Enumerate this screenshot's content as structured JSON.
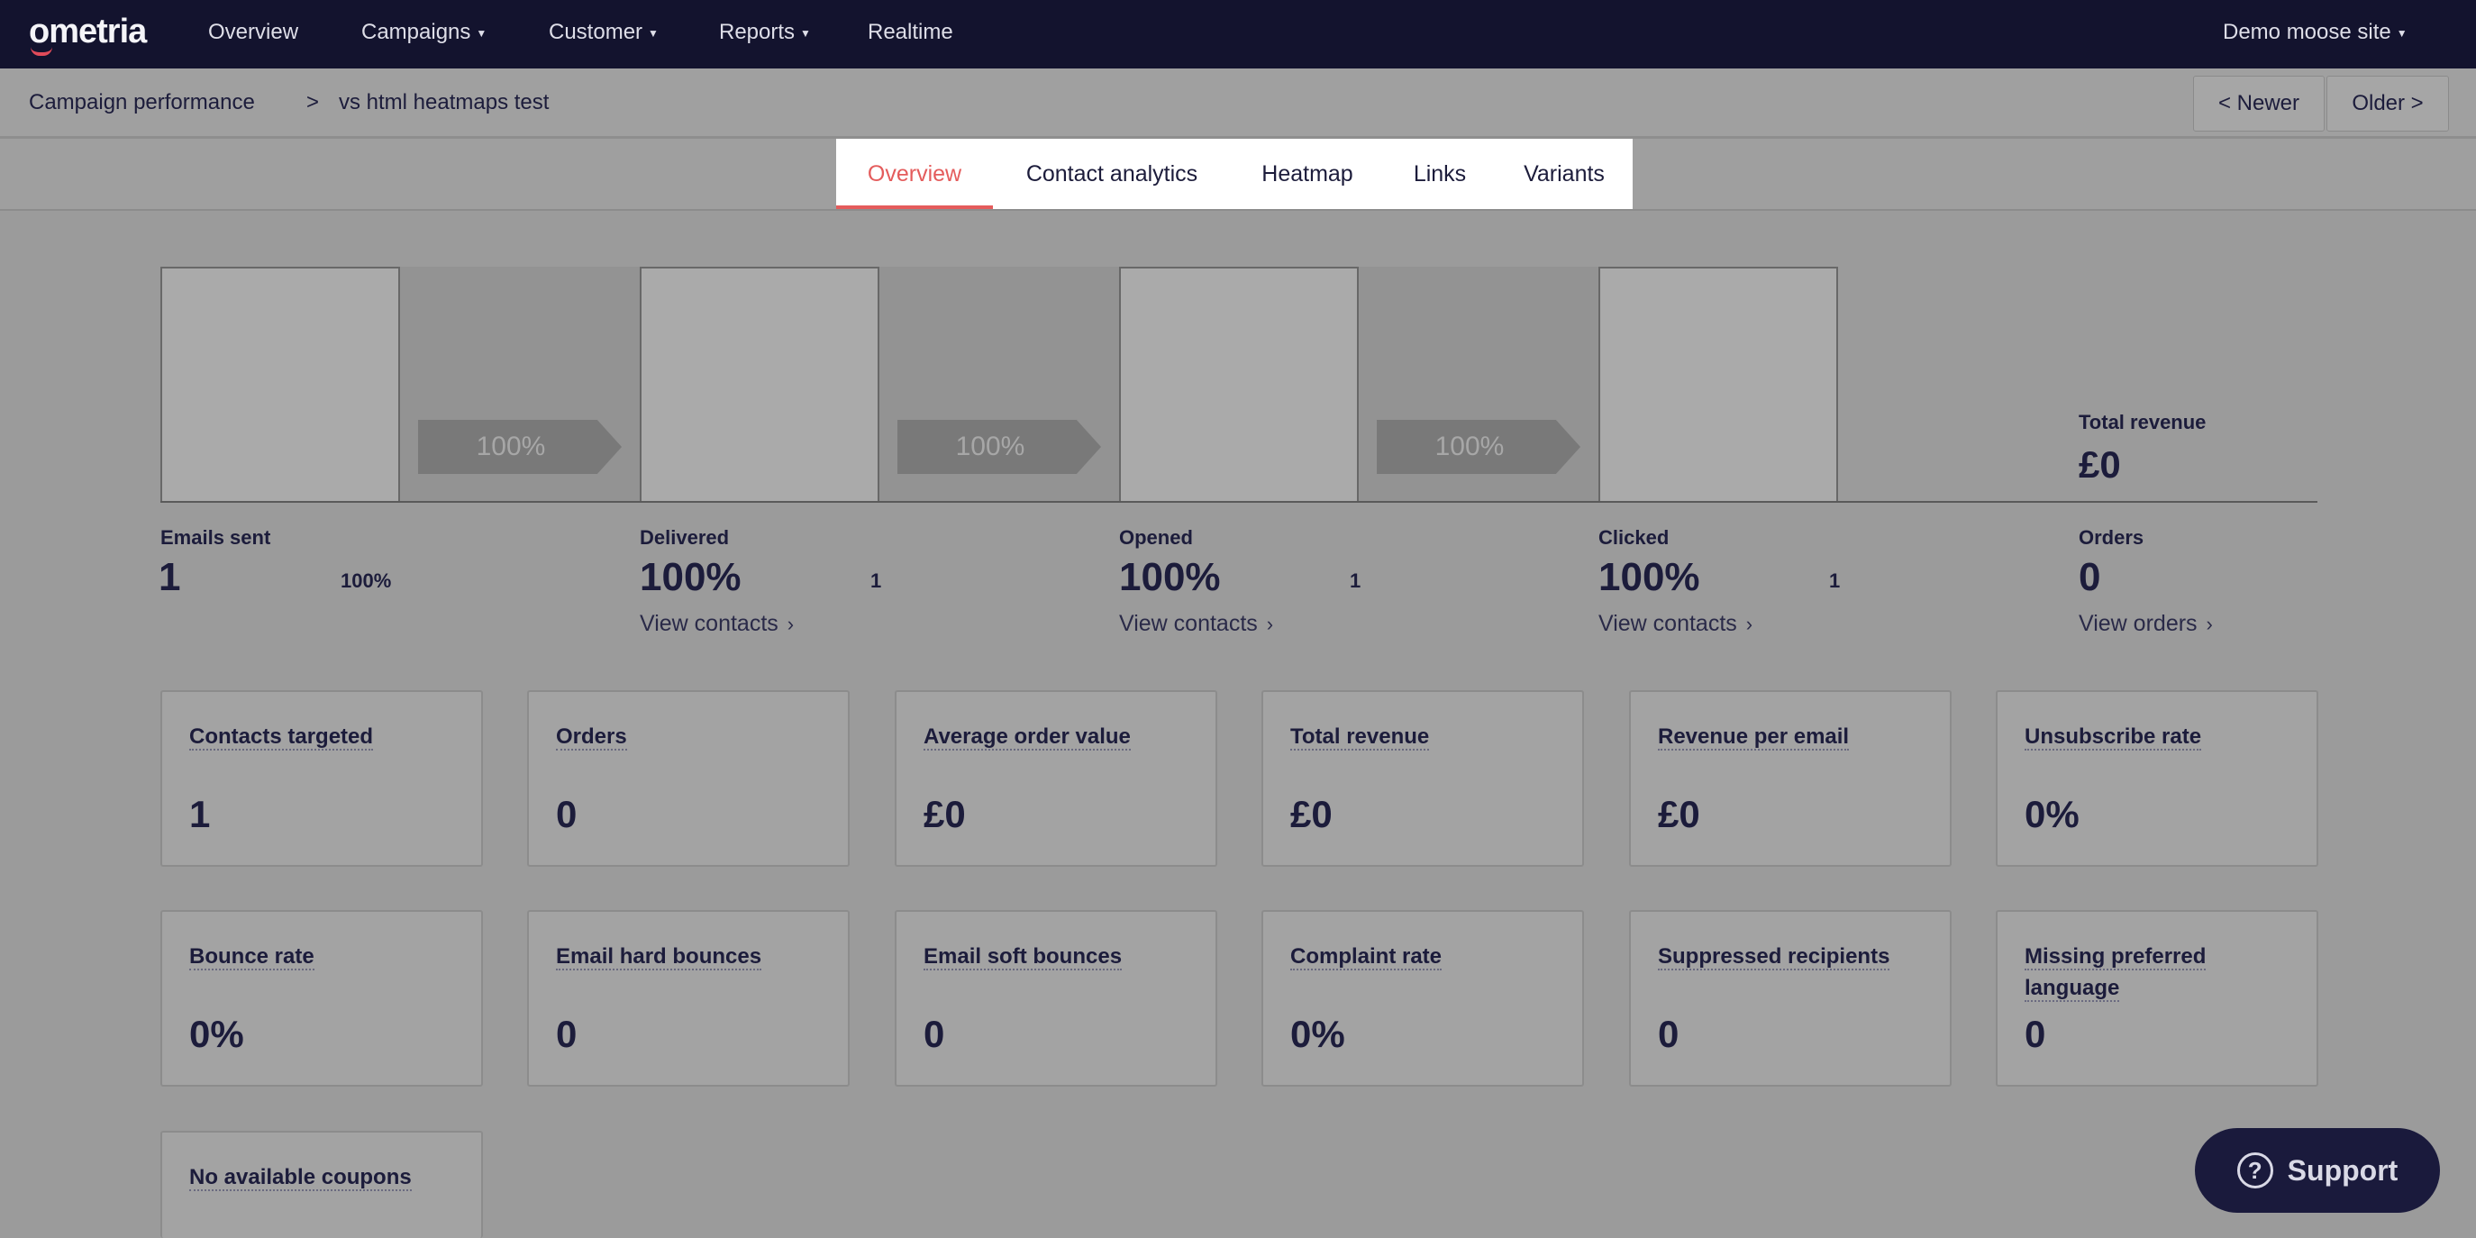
{
  "topnav": {
    "logo": "ometria",
    "items": [
      {
        "label": "Overview",
        "caret": false
      },
      {
        "label": "Campaigns",
        "caret": true
      },
      {
        "label": "Customer",
        "caret": true
      },
      {
        "label": "Reports",
        "caret": true
      },
      {
        "label": "Realtime",
        "caret": false
      }
    ],
    "site_selector": "Demo moose site"
  },
  "breadcrumb": {
    "root": "Campaign performance",
    "separator": ">",
    "current": "vs html heatmaps test",
    "newer_button": "< Newer",
    "older_button": "Older >"
  },
  "tabs": [
    {
      "label": "Overview",
      "active": true
    },
    {
      "label": "Contact analytics",
      "active": false
    },
    {
      "label": "Heatmap",
      "active": false
    },
    {
      "label": "Links",
      "active": false
    },
    {
      "label": "Variants",
      "active": false
    }
  ],
  "funnel": {
    "arrows": [
      "100%",
      "100%",
      "100%"
    ],
    "stages": [
      {
        "label": "Emails sent",
        "value": "1",
        "secondary": "100%",
        "link": ""
      },
      {
        "label": "Delivered",
        "value": "100%",
        "secondary": "1",
        "link": "View contacts"
      },
      {
        "label": "Opened",
        "value": "100%",
        "secondary": "1",
        "link": "View contacts"
      },
      {
        "label": "Clicked",
        "value": "100%",
        "secondary": "1",
        "link": "View contacts"
      }
    ],
    "total_revenue_label": "Total revenue",
    "total_revenue_value": "£0",
    "orders_label": "Orders",
    "orders_value": "0",
    "orders_link": "View orders"
  },
  "metrics": [
    {
      "title": "Contacts targeted",
      "value": "1"
    },
    {
      "title": "Orders",
      "value": "0"
    },
    {
      "title": "Average order value",
      "value": "£0"
    },
    {
      "title": "Total revenue",
      "value": "£0"
    },
    {
      "title": "Revenue per email",
      "value": "£0"
    },
    {
      "title": "Unsubscribe rate",
      "value": "0%"
    },
    {
      "title": "Bounce rate",
      "value": "0%"
    },
    {
      "title": "Email hard bounces",
      "value": "0"
    },
    {
      "title": "Email soft bounces",
      "value": "0"
    },
    {
      "title": "Complaint rate",
      "value": "0%"
    },
    {
      "title": "Suppressed recipients",
      "value": "0"
    },
    {
      "title": "Missing preferred language",
      "value": "0"
    },
    {
      "title": "No available coupons",
      "value": ""
    }
  ],
  "support": {
    "label": "Support",
    "icon": "question-icon"
  },
  "colors": {
    "nav_bg": "#13132e",
    "tab_active": "#e45c5c",
    "support_bg": "#1a1a3c"
  }
}
